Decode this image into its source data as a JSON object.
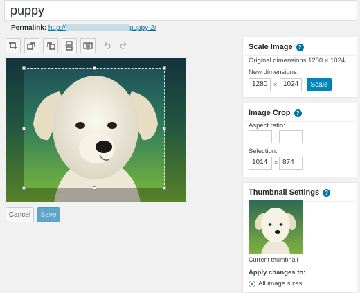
{
  "post_title": "puppy",
  "permalink": {
    "label": "Permalink:",
    "url_prefix": "http://",
    "url_suffix": "puppy-2/"
  },
  "toolbar": {
    "icons": [
      "crop-icon",
      "rotate-left-icon",
      "rotate-right-icon",
      "flip-vertical-icon",
      "flip-horizontal-icon",
      "undo-icon",
      "redo-icon"
    ]
  },
  "buttons": {
    "cancel": "Cancel",
    "save": "Save"
  },
  "scale_image": {
    "title": "Scale Image",
    "original": "Original dimensions 1280 × 1024",
    "new_dimensions_label": "New dimensions:",
    "width": "1280",
    "height": "1024",
    "times": "×",
    "button": "Scale"
  },
  "image_crop": {
    "title": "Image Crop",
    "aspect_label": "Aspect ratio:",
    "aspect_w": "",
    "aspect_h": "",
    "colon": ":",
    "selection_label": "Selection:",
    "sel_w": "1014",
    "sel_h": "874",
    "times": "×"
  },
  "thumbnail": {
    "title": "Thumbnail Settings",
    "caption": "Current thumbnail",
    "apply_label": "Apply changes to:",
    "option_all": "All image sizes"
  },
  "help_glyph": "?",
  "colors": {
    "primary": "#0085ba",
    "link": "#0073aa"
  }
}
